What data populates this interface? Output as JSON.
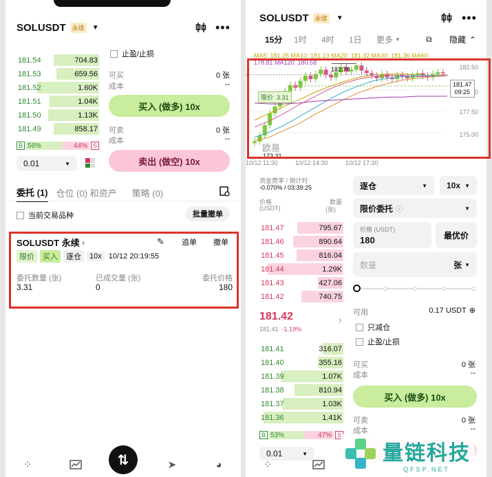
{
  "left": {
    "symbol": "SOLUSDT",
    "perp_badge": "永续",
    "tpsl_label": "止盈/止损",
    "asks": [
      {
        "price": "181.54",
        "qty": "704.83",
        "depth": 0.55
      },
      {
        "price": "181.53",
        "qty": "659.56",
        "depth": 0.52
      },
      {
        "price": "181.52",
        "qty": "1.60K",
        "depth": 0.75
      },
      {
        "price": "181.51",
        "qty": "1.04K",
        "depth": 0.6
      },
      {
        "price": "181.50",
        "qty": "1.13K",
        "depth": 0.62
      },
      {
        "price": "181.49",
        "qty": "858.17",
        "depth": 0.55
      }
    ],
    "buy_available_label": "可买",
    "buy_available_value": "0 张",
    "buy_cost_label": "成本",
    "buy_cost_value": "--",
    "buy_button": "买入 (做多) 10x",
    "sell_available_label": "可卖",
    "sell_available_value": "0 张",
    "sell_cost_label": "成本",
    "sell_cost_value": "--",
    "sell_button": "卖出 (做空) 10x",
    "ratio_b_label": "B",
    "ratio_b": "56%",
    "ratio_s": "44%",
    "ratio_s_label": "S",
    "ratio_b_fraction": 0.56,
    "precision": "0.01",
    "tabs": [
      "委托 (1)",
      "仓位 (0) 和资产",
      "策略 (0)"
    ],
    "current_only_label": "当前交易品种",
    "batch_cancel": "批量撤单",
    "order": {
      "title": "SOLUSDT 永续",
      "chevron": "›",
      "chase": "追单",
      "cancel": "撤单",
      "tags": [
        "限价",
        "买入",
        "逐仓",
        "10x"
      ],
      "time": "10/12 20:19:55",
      "qty_label": "委托数量 (张)",
      "qty_value": "3.31",
      "filled_label": "已成交量 (张)",
      "filled_value": "0",
      "price_label": "委托价格",
      "price_value": "180"
    }
  },
  "right": {
    "symbol": "SOLUSDT",
    "perp_badge": "永续",
    "timeframes": [
      "15分",
      "1时",
      "4时",
      "1日",
      "更多"
    ],
    "hide_label": "隐藏",
    "ma_line1": "MA5: 181.25  MA10: 181.13  MA20: 181.32  MA30: 181.36  MA60:",
    "ma_line2": "178.81  MA120: 180.58",
    "chart": {
      "y_ticks": [
        "182.50",
        "180.00",
        "177.50",
        "175.00"
      ],
      "x_ticks": [
        "10/12 11:30",
        "10/12 14:30",
        "10/12 17:30"
      ],
      "high_label": "182.78",
      "low_label": "173.31",
      "last_price": "181.47",
      "countdown": "09:25",
      "limit_tag": "限价",
      "limit_value": "3.31",
      "watermark": "欧易"
    },
    "funding_label": "资金费率 / 倒计时",
    "funding_value": "-0.070% / 03:39:25",
    "price_col": "价格",
    "price_unit": "(USDT)",
    "qty_col": "数量",
    "qty_unit": "(张)",
    "asks": [
      {
        "price": "181.47",
        "qty": "795.67",
        "depth": 0.55
      },
      {
        "price": "181.46",
        "qty": "890.64",
        "depth": 0.6
      },
      {
        "price": "181.45",
        "qty": "816.04",
        "depth": 0.56
      },
      {
        "price": "181.44",
        "qty": "1.29K",
        "depth": 0.9
      },
      {
        "price": "181.43",
        "qty": "427.06",
        "depth": 0.3
      },
      {
        "price": "181.42",
        "qty": "740.75",
        "depth": 0.5
      }
    ],
    "mid_price": "181.42",
    "mid_sub": "181.41",
    "mid_change": "-1.19%",
    "bids": [
      {
        "price": "181.41",
        "qty": "316.07",
        "depth": 0.25
      },
      {
        "price": "181.40",
        "qty": "355.16",
        "depth": 0.3
      },
      {
        "price": "181.39",
        "qty": "1.07K",
        "depth": 0.75
      },
      {
        "price": "181.38",
        "qty": "810.94",
        "depth": 0.58
      },
      {
        "price": "181.37",
        "qty": "1.03K",
        "depth": 0.72
      },
      {
        "price": "181.36",
        "qty": "1.41K",
        "depth": 0.95
      }
    ],
    "margin_mode": "逐仓",
    "leverage": "10x",
    "order_type": "限价委托",
    "price_field_label": "价格 (USDT)",
    "price_field_value": "180",
    "best_price": "最优价",
    "qty_placeholder": "数量",
    "qty_unit_sel": "张",
    "available_label": "可用",
    "available_value": "0.17 USDT",
    "reduce_only": "只减仓",
    "tpsl": "止盈/止损",
    "buy_avail_label": "可买",
    "buy_avail_value": "0 张",
    "buy_cost_label": "成本",
    "buy_cost_value": "--",
    "buy_button": "买入 (做多) 10x",
    "sell_avail_label": "可卖",
    "sell_avail_value": "0 张",
    "sell_cost_label": "成本",
    "sell_cost_value": "--",
    "ratio_b_label": "B",
    "ratio_b": "53%",
    "ratio_s": "47%",
    "ratio_s_label": "S",
    "ratio_b_fraction": 0.53,
    "precision": "0.01"
  },
  "watermark": {
    "name": "量链科技",
    "domain": "QFSP.NET"
  }
}
